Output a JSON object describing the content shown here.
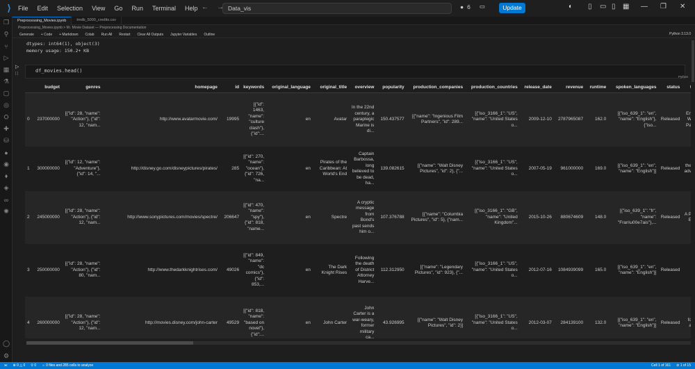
{
  "menu": [
    "File",
    "Edit",
    "Selection",
    "View",
    "Go",
    "Run",
    "Terminal",
    "Help"
  ],
  "search": "Data_vis",
  "badge_count": "6",
  "update_label": "Update",
  "tabs": [
    "Preprocessing_Movies.ipynb",
    "tmdb_5000_credits.csv"
  ],
  "breadcrumb": "Preprocessing_Movies.ipynb > M↓ Movie Dataset — Preprocessing Documentation",
  "toolbar": [
    "Generate",
    "+ Code",
    "+ Markdown",
    "Colab",
    "Run All",
    "Restart",
    "Clear All Outputs",
    "Jupyter Variables",
    "Outline"
  ],
  "kernel": "Python 3.13.0",
  "output_lines": [
    "dtypes: int64(1), object(3)",
    "memory usage: 150.2+ KB"
  ],
  "code": "df_movies.head()",
  "cell_lang": "Python",
  "table": {
    "columns": [
      "",
      "budget",
      "genres",
      "homepage",
      "id",
      "keywords",
      "original_language",
      "original_title",
      "overview",
      "popularity",
      "production_companies",
      "production_countries",
      "release_date",
      "revenue",
      "runtime",
      "spoken_languages",
      "status",
      "t"
    ],
    "rows": [
      [
        "0",
        "237000000",
        "[{\"id\": 28, \"name\": \"Action\"}, {\"id\": 12, \"nam...",
        "http://www.avatarmovie.com/",
        "19995",
        "[{\"id\": 1463, \"name\": \"culture clash\"}, {\"id\":...",
        "en",
        "Avatar",
        "In the 22nd century, a paraplegic Marine is di...",
        "150.437577",
        "[{\"name\": \"Ingenious Film Partners\", \"id\": 289...",
        "[{\"iso_3166_1\": \"US\", \"name\": \"United States o...",
        "2009-12-10",
        "2787965087",
        "162.0",
        "[{\"iso_639_1\": \"en\", \"name\": \"English\"}, {\"iso...",
        "Released",
        "En W Pa"
      ],
      [
        "1",
        "300000000",
        "[{\"id\": 12, \"name\": \"Adventure\"}, {\"id\": 14, \"...",
        "http://disney.go.com/disneypictures/pirates/",
        "285",
        "[{\"id\": 270, \"name\": \"ocean\"}, {\"id\": 726, \"na...",
        "en",
        "Pirates of the Caribbean: At World's End",
        "Captain Barbossa, long believed to be dead, ha...",
        "139.082615",
        "[{\"name\": \"Walt Disney Pictures\", \"id\": 2}, {\"...",
        "[{\"iso_3166_1\": \"US\", \"name\": \"United States o...",
        "2007-05-19",
        "961000000",
        "169.0",
        "[{\"iso_639_1\": \"en\", \"name\": \"English\"}]",
        "Released",
        "the adv"
      ],
      [
        "2",
        "245000000",
        "[{\"id\": 28, \"name\": \"Action\"}, {\"id\": 12, \"nam...",
        "http://www.sonypictures.com/movies/spectre/",
        "206647",
        "[{\"id\": 470, \"name\": \"spy\"}, {\"id\": 818, \"name...",
        "en",
        "Spectre",
        "A cryptic message from Bond's past sends him o...",
        "107.376788",
        "[{\"name\": \"Columbia Pictures\", \"id\": 5}, {\"nam...",
        "[{\"iso_3166_1\": \"GB\", \"name\": \"United Kingdom\"...",
        "2015-10-26",
        "880674609",
        "148.0",
        "[{\"iso_639_1\": \"fr\", \"name\": \"Fran\\u00e7ais\"},...",
        "Released",
        "A P E"
      ],
      [
        "3",
        "250000000",
        "[{\"id\": 28, \"name\": \"Action\"}, {\"id\": 80, \"nam...",
        "http://www.thedarkknightrises.com/",
        "49026",
        "[{\"id\": 849, \"name\": \"dc comics\"}, {\"id\": 853,...",
        "en",
        "The Dark Knight Rises",
        "Following the death of District Attorney Harve...",
        "112.312950",
        "[{\"name\": \"Legendary Pictures\", \"id\": 923}, {\"...",
        "[{\"iso_3166_1\": \"US\", \"name\": \"United States o...",
        "2012-07-16",
        "1084939099",
        "165.0",
        "[{\"iso_639_1\": \"en\", \"name\": \"English\"}]",
        "Released",
        ""
      ],
      [
        "4",
        "260000000",
        "[{\"id\": 28, \"name\": \"Action\"}, {\"id\": 12, \"nam...",
        "http://movies.disney.com/john-carter",
        "49529",
        "[{\"id\": 818, \"name\": \"based on novel\"}, {\"id\":...",
        "en",
        "John Carter",
        "John Carter is a war-weary, former military ca...",
        "43.926995",
        "[{\"name\": \"Walt Disney Pictures\", \"id\": 2}]",
        "[{\"iso_3166_1\": \"US\", \"name\": \"United States o...",
        "2012-03-07",
        "284139100",
        "132.0",
        "[{\"iso_639_1\": \"en\", \"name\": \"English\"}]",
        "Released",
        "fo a"
      ]
    ]
  },
  "status": {
    "left": [
      "⊗ 0 △ 0",
      "⚲ 0",
      "☼ 0 files and 285 cells to analyze"
    ],
    "right": [
      "Cell 1 of 161",
      "⊘ 1 of 15"
    ]
  }
}
